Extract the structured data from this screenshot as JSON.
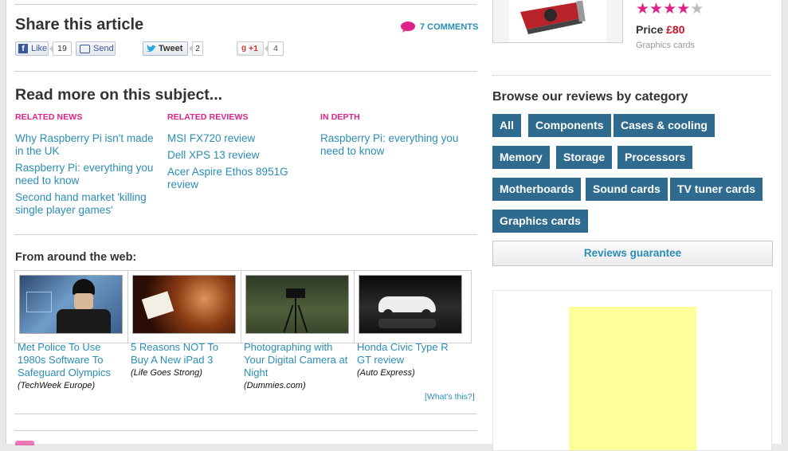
{
  "share": {
    "title": "Share this article",
    "comments": "7 COMMENTS",
    "like_label": "Like",
    "like_count": "19",
    "send_label": "Send",
    "tweet_label": "Tweet",
    "tweet_count": "2",
    "gplus_label": "+1",
    "gplus_count": "4"
  },
  "read_more": {
    "title": "Read more on this subject...",
    "columns": [
      {
        "label": "RELATED NEWS",
        "items": [
          "Why Raspberry Pi isn't made in the UK",
          "Raspberry Pi: everything you need to know",
          "Second hand market 'killing single player games'"
        ]
      },
      {
        "label": "RELATED REVIEWS",
        "items": [
          "MSI FX720 review",
          "Dell XPS 13 review",
          "Acer Aspire Ethos 8951G review"
        ]
      },
      {
        "label": "IN DEPTH",
        "items": [
          "Raspberry Pi: everything you need to know"
        ]
      }
    ]
  },
  "web": {
    "title": "From around the web:",
    "items": [
      {
        "title": "Met Police To Use 1980s Software To Safeguard Olympics",
        "source": "(TechWeek Europe)"
      },
      {
        "title": "5 Reasons NOT To Buy A New iPad 3",
        "source": "(Life Goes Strong)"
      },
      {
        "title": "Photographing with Your Digital Camera at Night",
        "source": "(Dummies.com)"
      },
      {
        "title": "Honda Civic Type R GT review",
        "source": "(Auto Express)"
      }
    ],
    "whats_this": "[What's this?]"
  },
  "product": {
    "rating": 4,
    "rating_max": 5,
    "price_label": "Price",
    "price": "£80",
    "category": "Graphics cards"
  },
  "browse": {
    "title": "Browse our reviews by category",
    "categories": [
      "All",
      "Components",
      "Cases & cooling",
      "Memory",
      "Storage",
      "Processors",
      "Motherboards",
      "Sound cards",
      "TV tuner cards",
      "Graphics cards"
    ],
    "guarantee": "Reviews guarantee"
  },
  "colors": {
    "accent_pink": "#e0218a",
    "link_blue": "#2b8db5",
    "category_bg": "#2f6b8e",
    "ad_yellow": "#ffff99"
  }
}
